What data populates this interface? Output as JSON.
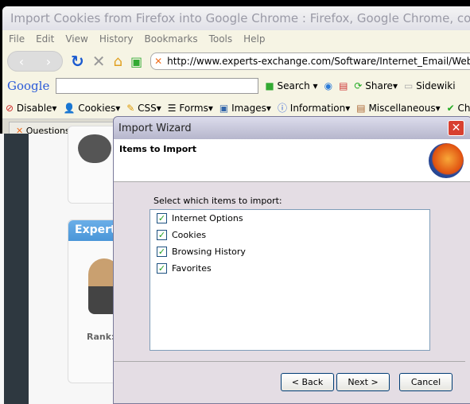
{
  "browser": {
    "title": "Import Cookies from Firefox into Google Chrome : Firefox, Google Chrome, cookies, browser",
    "menu": [
      "File",
      "Edit",
      "View",
      "History",
      "Bookmarks",
      "Tools",
      "Help"
    ],
    "url": "http://www.experts-exchange.com/Software/Internet_Email/Web_Br",
    "google": {
      "logo": "Google",
      "search": "Search",
      "share": "Share",
      "sidewiki": "Sidewiki"
    },
    "webdev": [
      "Disable",
      "Cookies",
      "CSS",
      "Forms",
      "Images",
      "Information",
      "Miscellaneous",
      "Check"
    ],
    "tab": "Questions Awaiting An"
  },
  "page": {
    "card_title": "Expert",
    "rank_label": "Rank:"
  },
  "dialog": {
    "title": "Import Wizard",
    "heading": "Items to Import",
    "prompt": "Select which items to import:",
    "items": [
      {
        "label": "Internet Options",
        "checked": true
      },
      {
        "label": "Cookies",
        "checked": true
      },
      {
        "label": "Browsing History",
        "checked": true
      },
      {
        "label": "Favorites",
        "checked": true
      }
    ],
    "back": "< Back",
    "next": "Next >",
    "cancel": "Cancel"
  }
}
